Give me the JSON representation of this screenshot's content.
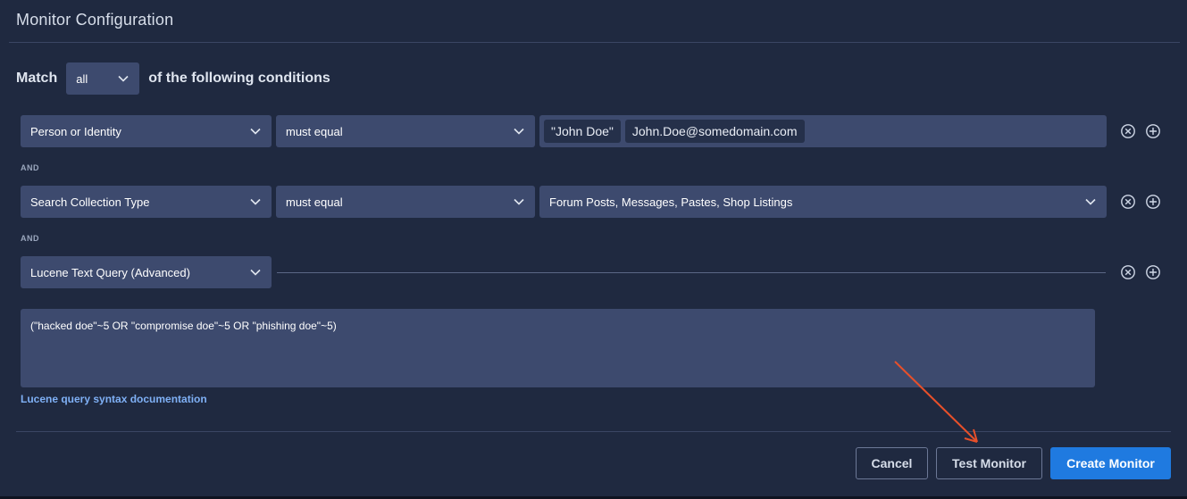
{
  "header": {
    "title": "Monitor Configuration"
  },
  "match": {
    "prefix": "Match",
    "selected": "all",
    "suffix": "of the following conditions"
  },
  "conditions": [
    {
      "field": "Person or Identity",
      "operator": "must equal",
      "tags": [
        "\"John Doe\"",
        "John.Doe@somedomain.com"
      ]
    },
    {
      "joiner": "AND",
      "field": "Search Collection Type",
      "operator": "must equal",
      "value": "Forum Posts, Messages, Pastes, Shop Listings"
    },
    {
      "joiner": "AND",
      "field": "Lucene Text Query (Advanced)",
      "query": "(\"hacked doe\"~5 OR \"compromise doe\"~5 OR \"phishing doe\"~5)",
      "doc_link": "Lucene query syntax documentation"
    }
  ],
  "footer": {
    "cancel_label": "Cancel",
    "test_label": "Test Monitor",
    "create_label": "Create Monitor"
  },
  "colors": {
    "background": "#1f2940",
    "field": "#3d4a6e",
    "primary": "#1f7ae0",
    "link": "#7fb0f5",
    "annotation_arrow": "#e8502a"
  },
  "icons": {
    "dropdown": "chevron-down-icon",
    "remove": "circle-x-icon",
    "add": "circle-plus-icon"
  }
}
